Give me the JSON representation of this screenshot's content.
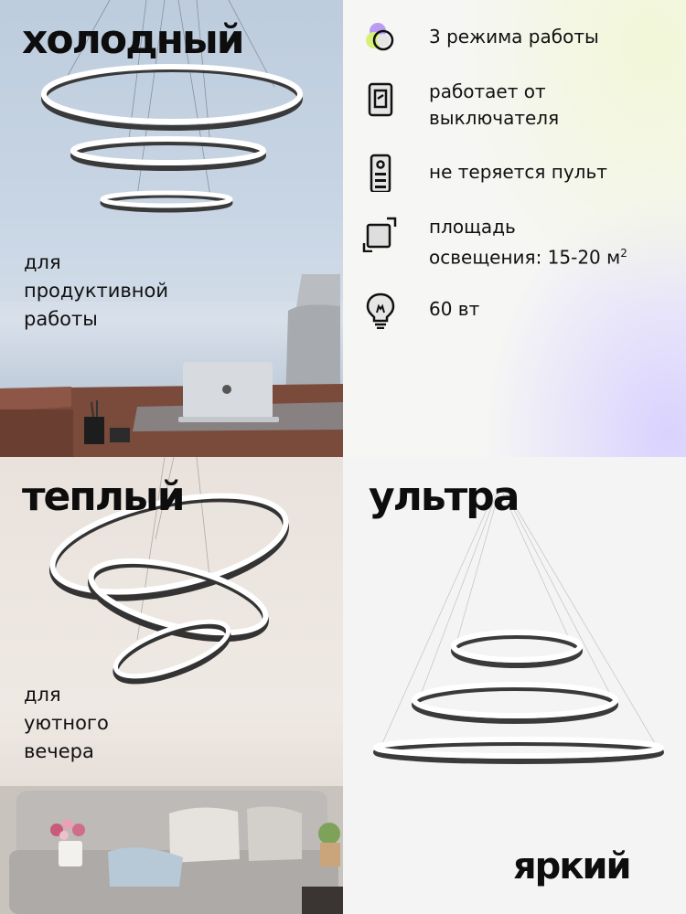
{
  "panels": {
    "cold": {
      "title": "холодный",
      "caption": [
        "для",
        "продуктивной",
        "работы"
      ]
    },
    "warm": {
      "title": "теплый",
      "caption": [
        "для",
        "уютного",
        "вечера"
      ]
    },
    "ultra": {
      "title": "ультра",
      "subtitle": "яркий"
    }
  },
  "features": [
    {
      "icon": "modes-icon",
      "lines": [
        "3 режима работы"
      ]
    },
    {
      "icon": "wall-switch-icon",
      "lines": [
        "работает от",
        "выключателя"
      ]
    },
    {
      "icon": "remote-control-icon",
      "lines": [
        "не теряется пульт"
      ]
    },
    {
      "icon": "area-icon",
      "lines": [
        "площадь"
      ],
      "area_line": "освещения: 15-20 м",
      "area_sup": "2"
    },
    {
      "icon": "lightbulb-icon",
      "lines": [
        "60 вт"
      ]
    }
  ],
  "colors": {
    "ring_dark": "#3a3a3a",
    "ring_light": "#ffffff",
    "accent_purple": "#b99cf2",
    "accent_lime": "#d7f07a"
  }
}
